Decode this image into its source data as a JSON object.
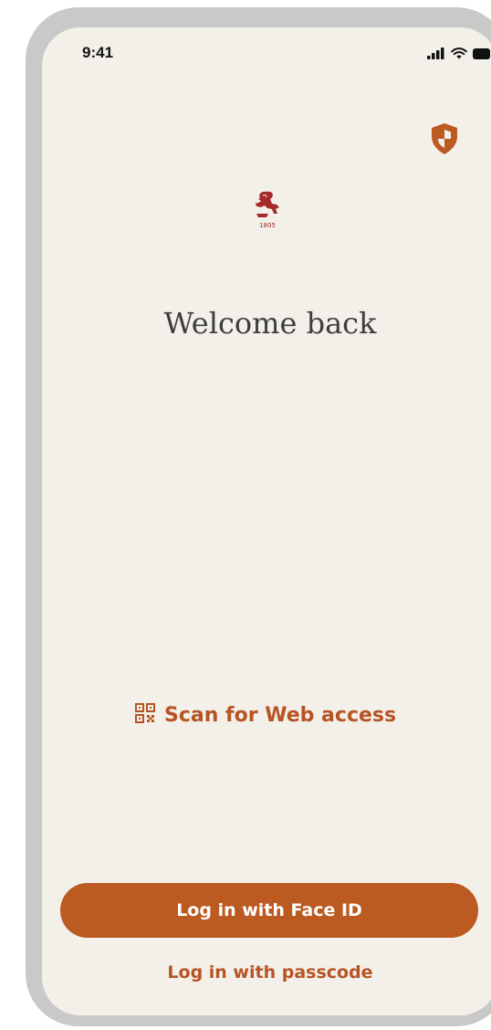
{
  "status_bar": {
    "time": "9:41"
  },
  "logo": {
    "year": "1805"
  },
  "welcome": {
    "title": "Welcome back"
  },
  "scan": {
    "label": "Scan for Web access"
  },
  "actions": {
    "faceid_label": "Log in with Face ID",
    "passcode_label": "Log in with passcode"
  },
  "colors": {
    "accent": "#bb5b22",
    "background": "#f3f0e9",
    "logo_red": "#a52a2a"
  },
  "icons": {
    "security": "shield-icon",
    "logo": "lion-logo-icon",
    "scan": "qr-code-icon",
    "signal": "signal-icon",
    "wifi": "wifi-icon",
    "battery": "battery-icon"
  }
}
